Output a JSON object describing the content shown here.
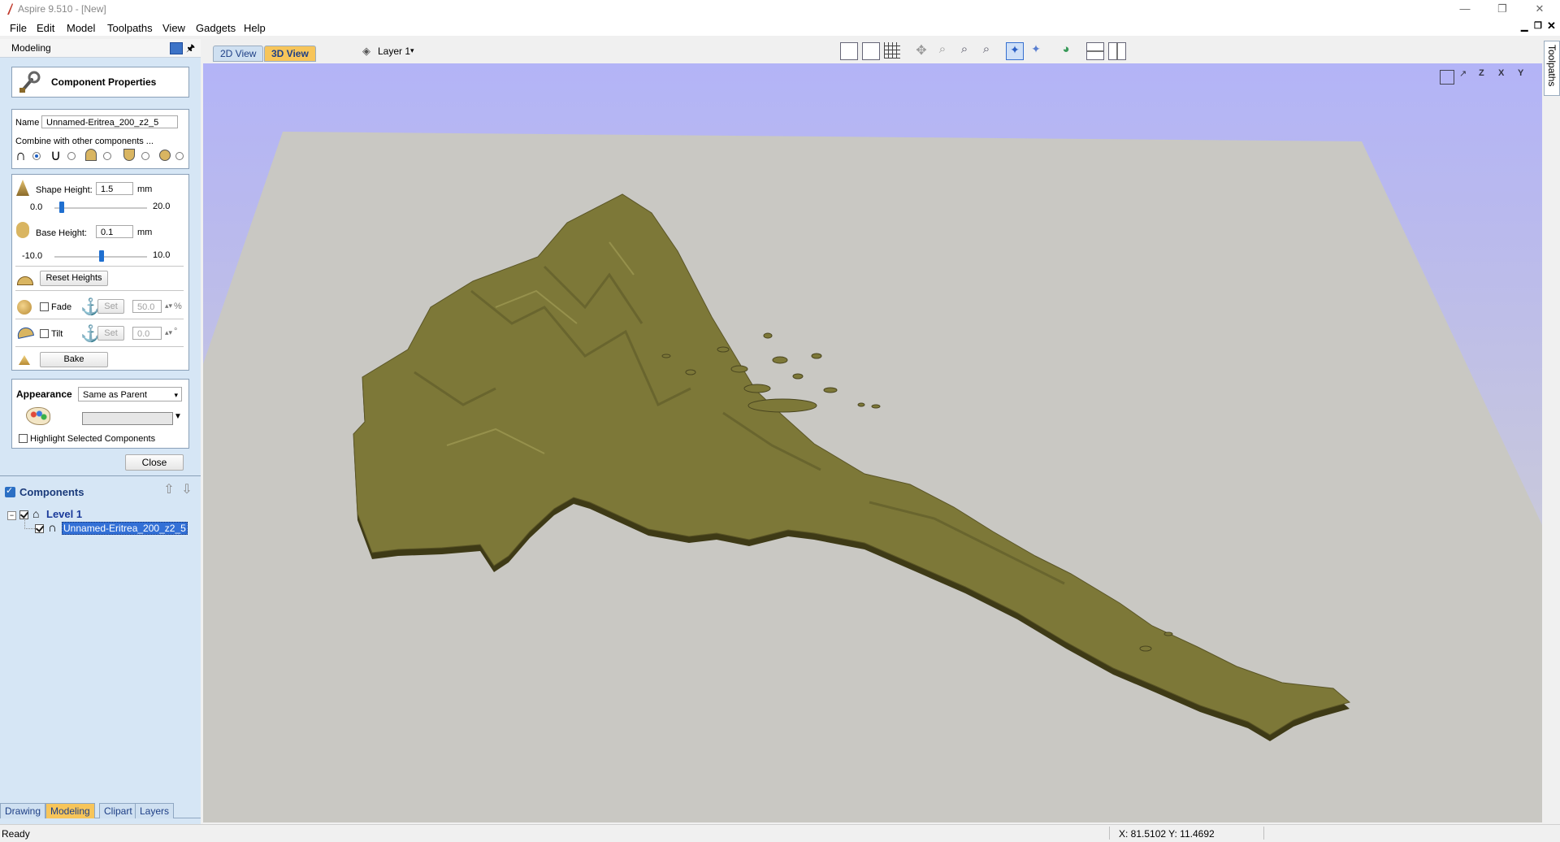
{
  "window": {
    "title": "Aspire 9.510 - [New]"
  },
  "menu": [
    "File",
    "Edit",
    "Model",
    "Toolpaths",
    "View",
    "Gadgets",
    "Help"
  ],
  "panel": {
    "title": "Modeling",
    "form_title": "Component Properties",
    "name_label": "Name",
    "name_value": "Unnamed-Eritrea_200_z2_5",
    "combine_label": "Combine with other components ...",
    "shape_height_label": "Shape Height:",
    "shape_height_value": "1.5",
    "shape_height_unit": "mm",
    "shape_min": "0.0",
    "shape_max": "20.0",
    "shape_level": 0.075,
    "base_height_label": "Base Height:",
    "base_height_value": "0.1",
    "base_height_unit": "mm",
    "base_min": "-10.0",
    "base_max": "10.0",
    "base_level": 0.505,
    "reset_label": "Reset Heights",
    "fade_label": "Fade",
    "fade_set": "Set",
    "fade_value": "50.0",
    "fade_unit": "%",
    "tilt_label": "Tilt",
    "tilt_set": "Set",
    "tilt_value": "0.0",
    "tilt_unit": "°",
    "bake_label": "Bake",
    "appearance_label": "Appearance",
    "appearance_value": "Same as Parent",
    "highlight_label": "Highlight Selected Components",
    "close_label": "Close"
  },
  "components": {
    "title": "Components",
    "level": "Level 1",
    "item": "Unnamed-Eritrea_200_z2_5"
  },
  "bottom_tabs": [
    "Drawing",
    "Modeling",
    "Clipart",
    "Layers"
  ],
  "view_tabs": [
    "2D View",
    "3D View"
  ],
  "layer_label": "Layer 1",
  "right_tab": "Toolpaths",
  "axis_buttons": [
    "X",
    "Z",
    "X",
    "Y"
  ],
  "status": {
    "ready": "Ready",
    "coords": "X: 81.5102 Y: 11.4692"
  },
  "colors": {
    "model": "#7d7838",
    "sky": "#b3b4f7",
    "floor": "#c9c8c3",
    "tab_active": "#f7c55a"
  }
}
